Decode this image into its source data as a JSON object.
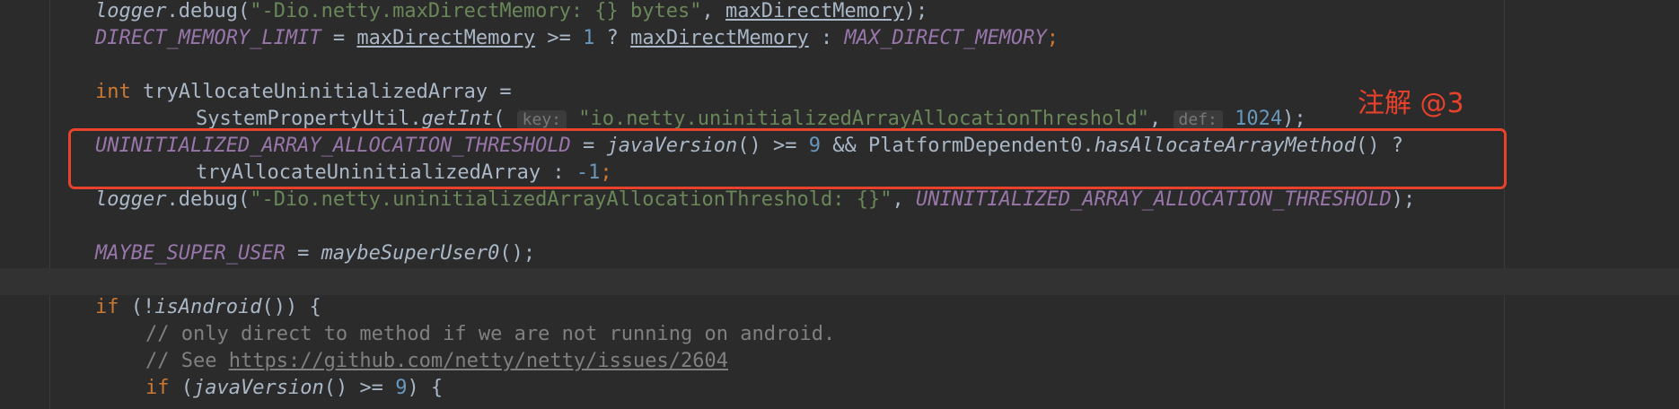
{
  "code": {
    "l1": {
      "logger": "logger",
      "dot_debug": ".debug(",
      "str": "\"-Dio.netty.maxDirectMemory: {} bytes\"",
      "comma": ", ",
      "field": "maxDirectMemory",
      "end": ");"
    },
    "l2": {
      "const": "DIRECT_MEMORY_LIMIT",
      "eq": " = ",
      "field1": "maxDirectMemory",
      "op": " >= ",
      "num": "1",
      "q": " ? ",
      "field2": "maxDirectMemory",
      "colon": " : ",
      "const2": "MAX_DIRECT_MEMORY",
      "semi": ";"
    },
    "l4": {
      "kw": "int",
      "rest": " tryAllocateUninitializedArray ="
    },
    "l5": {
      "cls": "SystemPropertyUtil.",
      "method": "getInt",
      "paren": "(",
      "hint_key": "key:",
      "str": "\"io.netty.uninitializedArrayAllocationThreshold\"",
      "comma": ", ",
      "hint_def": "def:",
      "num": "1024",
      "end": ");"
    },
    "l6": {
      "const": "UNINITIALIZED_ARRAY_ALLOCATION_THRESHOLD",
      "eq": " = ",
      "method1": "javaVersion",
      "p1": "() >= ",
      "num": "9",
      "and": " && PlatformDependent0.",
      "method2": "hasAllocateArrayMethod",
      "p2": "() ?"
    },
    "l7": {
      "text": "tryAllocateUninitializedArray : ",
      "num": "-1",
      "semi": ";"
    },
    "l8": {
      "logger": "logger",
      "dot_debug": ".debug(",
      "str": "\"-Dio.netty.uninitializedArrayAllocationThreshold: {}\"",
      "comma": ", ",
      "const": "UNINITIALIZED_ARRAY_ALLOCATION_THRESHOLD",
      "end": ");"
    },
    "l10": {
      "const": "MAYBE_SUPER_USER",
      "eq": " = ",
      "method": "maybeSuperUser0",
      "end": "();"
    },
    "l12": {
      "kw": "if",
      "p1": " (!",
      "method": "isAndroid",
      "p2": "()) {"
    },
    "l13": {
      "cmt": "// only direct to method if we are not running on android."
    },
    "l14": {
      "cmt": "// See ",
      "link": "https://github.com/netty/netty/issues/2604"
    },
    "l15": {
      "kw": "if",
      "p1": " (",
      "method": "javaVersion",
      "p2": "() >= ",
      "num": "9",
      "p3": ") {"
    }
  },
  "annotation": {
    "label": "注解 @3",
    "color": "#e8412c"
  },
  "colors": {
    "background": "#2b2b2b",
    "keyword": "#cc7832",
    "constant": "#9876aa",
    "string": "#6a8759",
    "number": "#6897bb",
    "comment": "#808080",
    "text": "#a9b7c6"
  }
}
